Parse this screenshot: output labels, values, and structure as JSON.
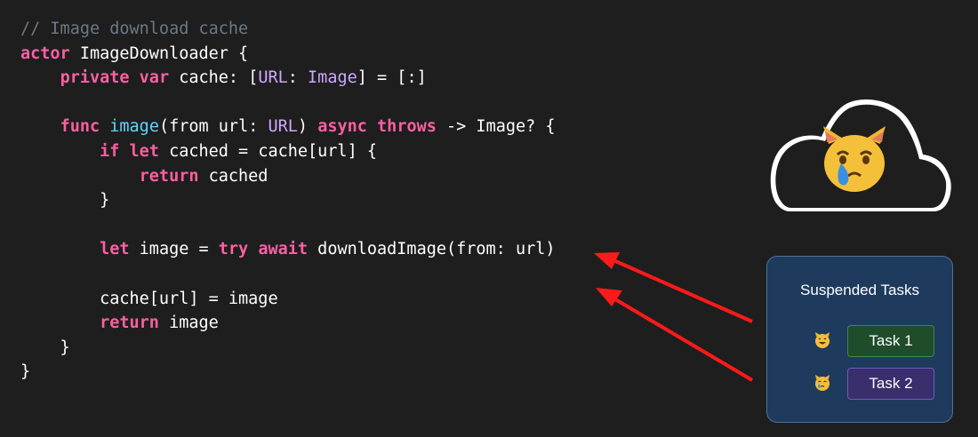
{
  "code": {
    "lines": [
      [
        {
          "t": "comment",
          "s": "// Image download cache"
        }
      ],
      [
        {
          "t": "keyword",
          "s": "actor"
        },
        {
          "t": "plain",
          "s": " ImageDownloader {"
        }
      ],
      [
        {
          "t": "plain",
          "s": "    "
        },
        {
          "t": "keyword",
          "s": "private"
        },
        {
          "t": "plain",
          "s": " "
        },
        {
          "t": "keyword",
          "s": "var"
        },
        {
          "t": "plain",
          "s": " cache: ["
        },
        {
          "t": "type",
          "s": "URL"
        },
        {
          "t": "plain",
          "s": ": "
        },
        {
          "t": "type",
          "s": "Image"
        },
        {
          "t": "plain",
          "s": "] = [:]"
        }
      ],
      [],
      [
        {
          "t": "plain",
          "s": "    "
        },
        {
          "t": "keyword",
          "s": "func"
        },
        {
          "t": "plain",
          "s": " "
        },
        {
          "t": "func",
          "s": "image"
        },
        {
          "t": "plain",
          "s": "(from url: "
        },
        {
          "t": "type",
          "s": "URL"
        },
        {
          "t": "plain",
          "s": ") "
        },
        {
          "t": "keyword",
          "s": "async"
        },
        {
          "t": "plain",
          "s": " "
        },
        {
          "t": "keyword",
          "s": "throws"
        },
        {
          "t": "plain",
          "s": " -> Image? {"
        }
      ],
      [
        {
          "t": "plain",
          "s": "        "
        },
        {
          "t": "keyword",
          "s": "if"
        },
        {
          "t": "plain",
          "s": " "
        },
        {
          "t": "keyword",
          "s": "let"
        },
        {
          "t": "plain",
          "s": " cached = cache[url] {"
        }
      ],
      [
        {
          "t": "plain",
          "s": "            "
        },
        {
          "t": "keyword",
          "s": "return"
        },
        {
          "t": "plain",
          "s": " cached"
        }
      ],
      [
        {
          "t": "plain",
          "s": "        }"
        }
      ],
      [],
      [
        {
          "t": "plain",
          "s": "        "
        },
        {
          "t": "keyword",
          "s": "let"
        },
        {
          "t": "plain",
          "s": " image = "
        },
        {
          "t": "keyword",
          "s": "try"
        },
        {
          "t": "plain",
          "s": " "
        },
        {
          "t": "keyword",
          "s": "await"
        },
        {
          "t": "plain",
          "s": " downloadImage(from: url)"
        }
      ],
      [],
      [
        {
          "t": "plain",
          "s": "        cache[url] = image"
        }
      ],
      [
        {
          "t": "plain",
          "s": "        "
        },
        {
          "t": "keyword",
          "s": "return"
        },
        {
          "t": "plain",
          "s": " image"
        }
      ],
      [
        {
          "t": "plain",
          "s": "    }"
        }
      ],
      [
        {
          "t": "plain",
          "s": "}"
        }
      ]
    ]
  },
  "cloud": {
    "emoji_icon": "crying-cat-icon"
  },
  "panel": {
    "title": "Suspended Tasks",
    "tasks": [
      {
        "label": "Task 1",
        "emoji_icon": "smiling-cat-icon",
        "color": "#1f4d2c"
      },
      {
        "label": "Task 2",
        "emoji_icon": "crying-cat-icon",
        "color": "#3a2e6c"
      }
    ]
  },
  "colors": {
    "background": "#1e1e1e",
    "keyword": "#fc5fa3",
    "type": "#d0a8ff",
    "function": "#5dd8ff",
    "comment": "#6c7986",
    "arrow": "#ff1a1a",
    "panel_bg": "#1e3b5e"
  }
}
